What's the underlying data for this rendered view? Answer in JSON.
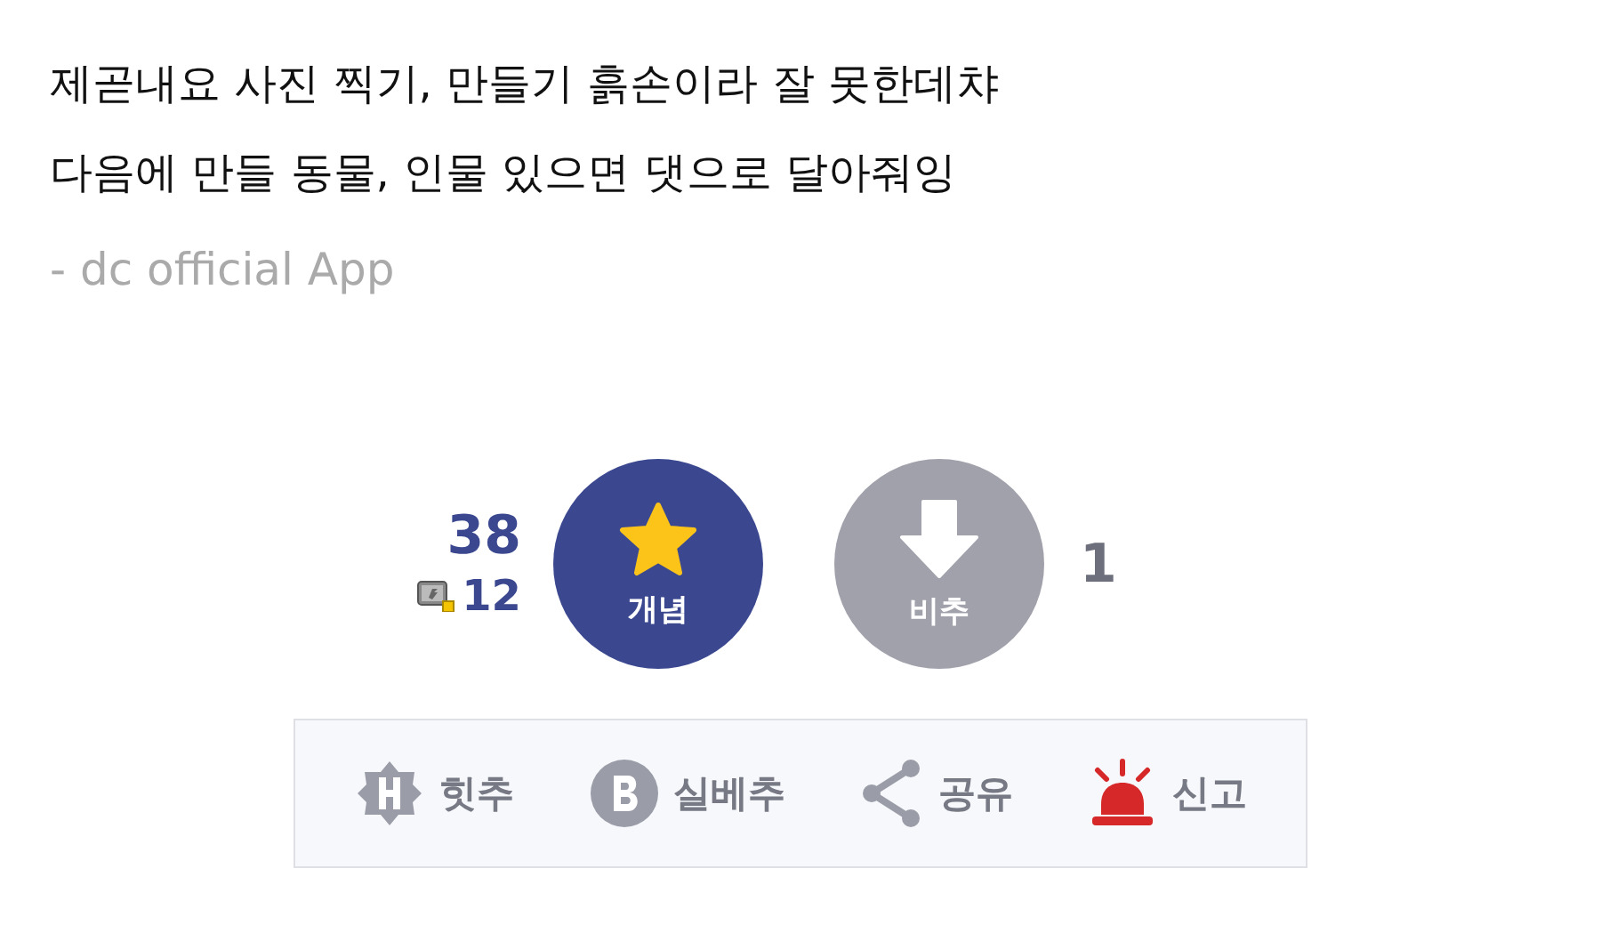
{
  "post": {
    "lines": [
      "제곧내요 사진 찍기, 만들기 흙손이라 잘 못한데챠",
      "다음에 만들 동물, 인물 있으면 댓으로 달아줘잉"
    ],
    "signature": "- dc official App"
  },
  "vote": {
    "up_count": "38",
    "fixed_count": "12",
    "up_label": "개념",
    "down_label": "비추",
    "down_count": "1"
  },
  "actions": [
    {
      "kind": "hit",
      "label": "힛추"
    },
    {
      "kind": "best",
      "label": "실베추"
    },
    {
      "kind": "share",
      "label": "공유"
    },
    {
      "kind": "report",
      "label": "신고"
    }
  ]
}
